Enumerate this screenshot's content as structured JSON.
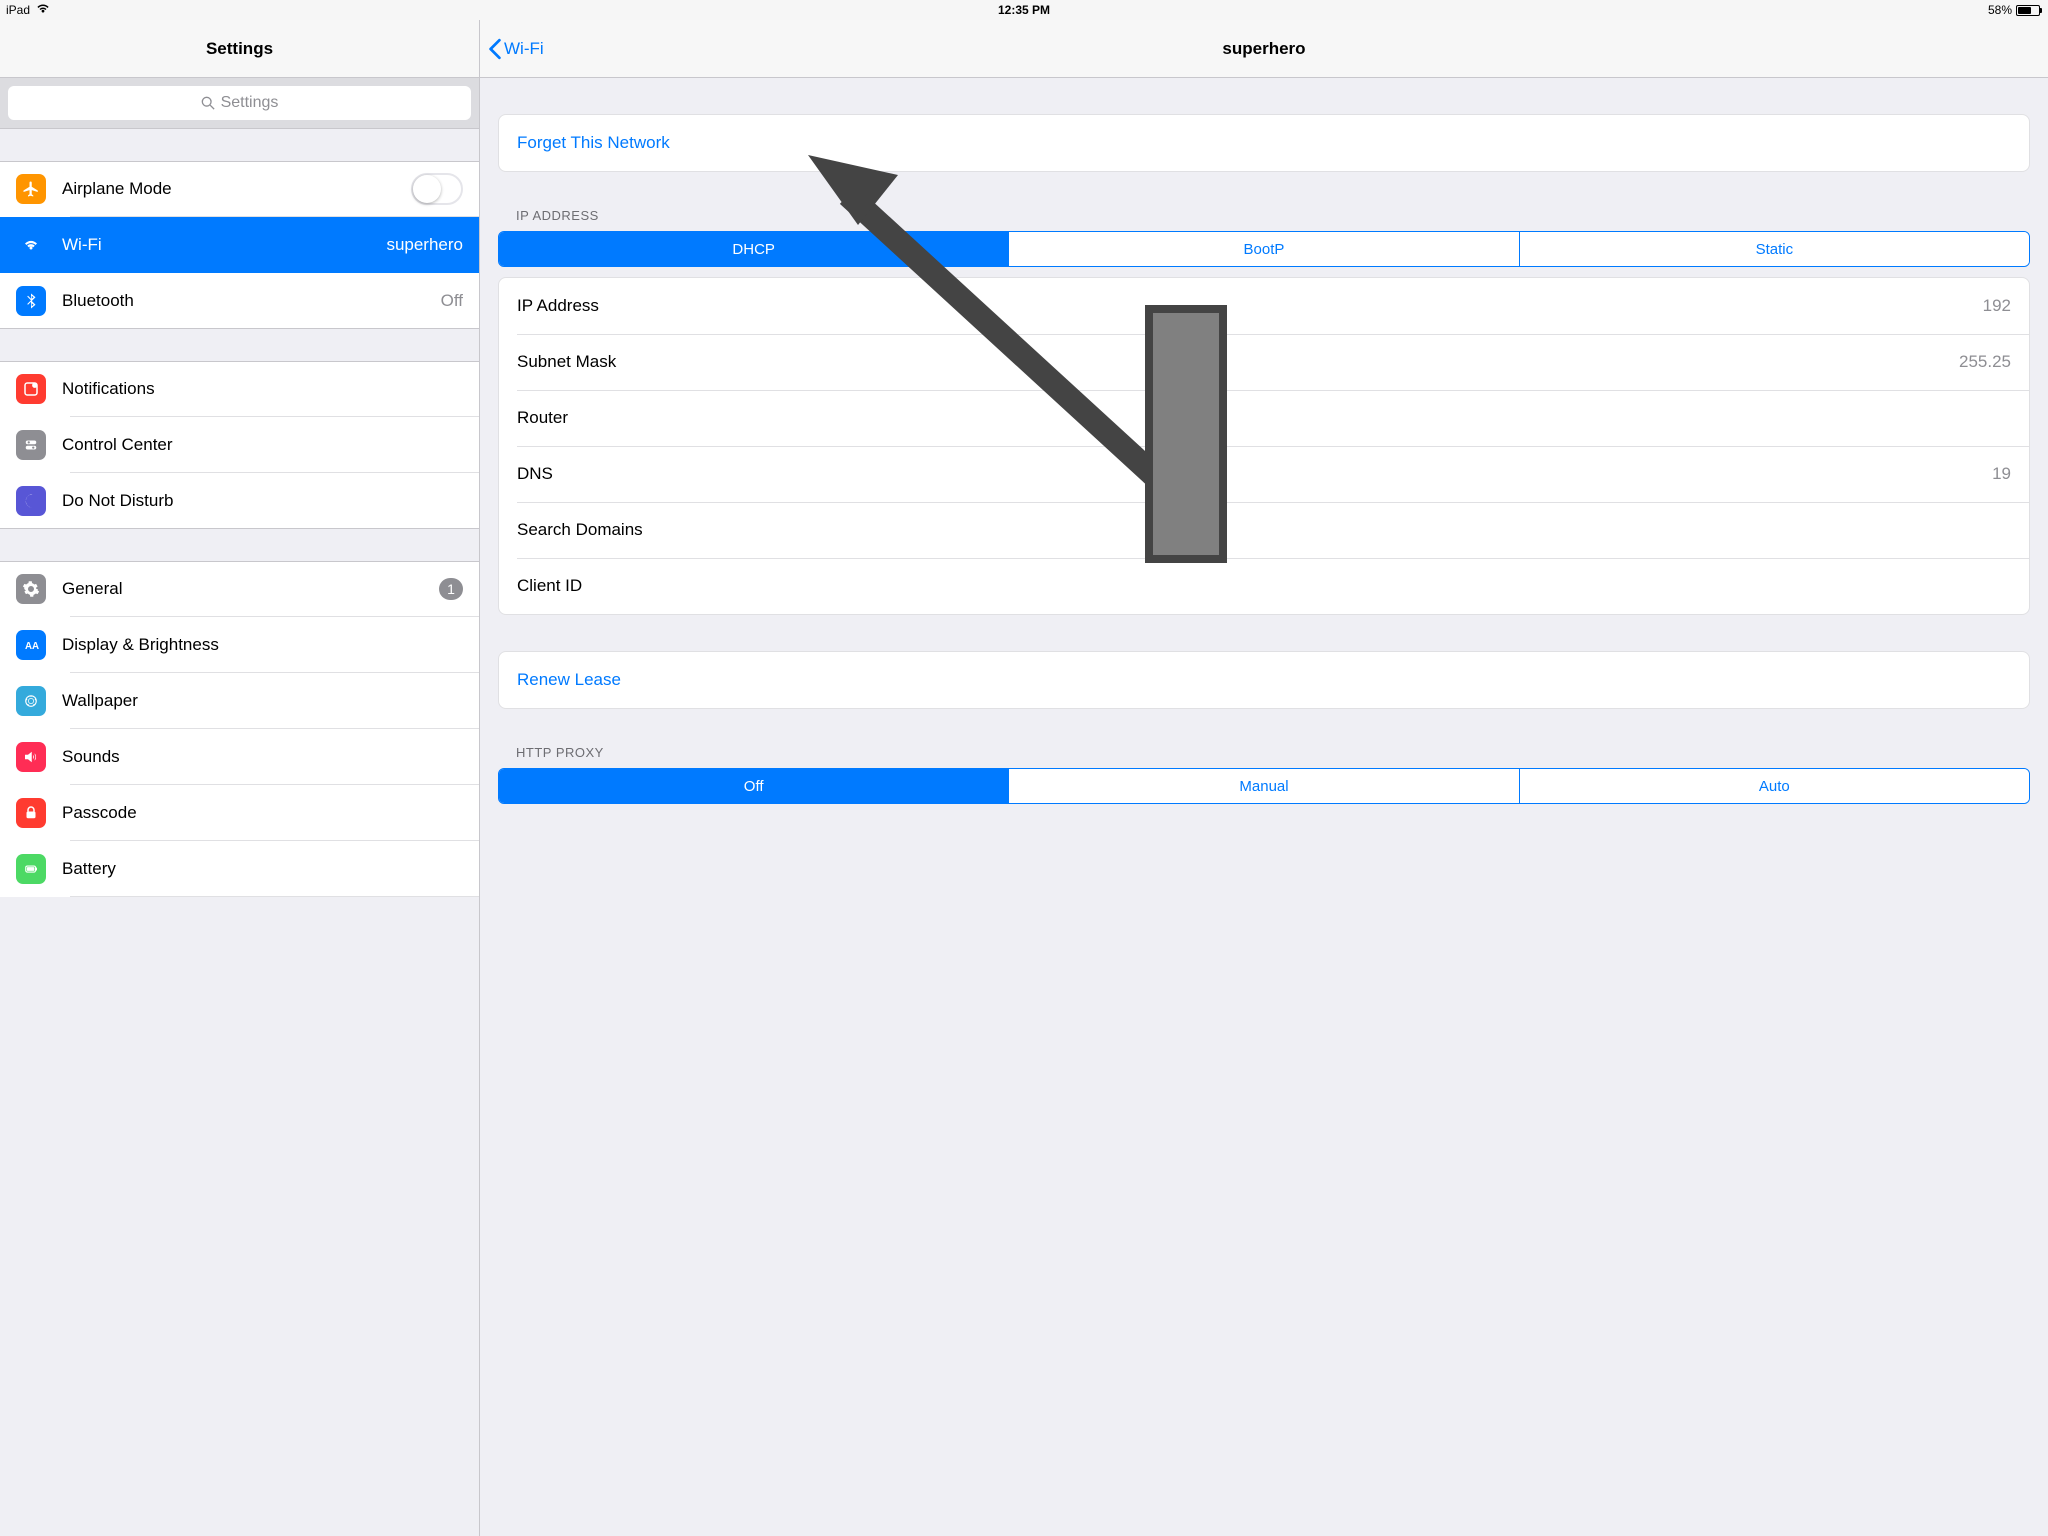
{
  "status": {
    "device": "iPad",
    "time": "12:35 PM",
    "battery_pct": "58%"
  },
  "sidebar": {
    "title": "Settings",
    "search_placeholder": "Settings",
    "group1": {
      "airplane": "Airplane Mode",
      "wifi": "Wi-Fi",
      "wifi_value": "superhero",
      "bluetooth": "Bluetooth",
      "bluetooth_value": "Off"
    },
    "group2": {
      "notifications": "Notifications",
      "control_center": "Control Center",
      "dnd": "Do Not Disturb"
    },
    "group3": {
      "general": "General",
      "general_badge": "1",
      "display": "Display & Brightness",
      "wallpaper": "Wallpaper",
      "sounds": "Sounds",
      "passcode": "Passcode",
      "battery": "Battery"
    }
  },
  "detail": {
    "back_label": "Wi-Fi",
    "title": "superhero",
    "forget": "Forget This Network",
    "ip_header": "IP ADDRESS",
    "seg_ip": {
      "a": "DHCP",
      "b": "BootP",
      "c": "Static"
    },
    "rows": {
      "ip_label": "IP Address",
      "ip_value": "192",
      "subnet_label": "Subnet Mask",
      "subnet_value": "255.25",
      "router_label": "Router",
      "dns_label": "DNS",
      "dns_value": "19",
      "search_label": "Search Domains",
      "client_label": "Client ID"
    },
    "renew": "Renew Lease",
    "proxy_header": "HTTP PROXY",
    "seg_proxy": {
      "a": "Off",
      "b": "Manual",
      "c": "Auto"
    }
  }
}
